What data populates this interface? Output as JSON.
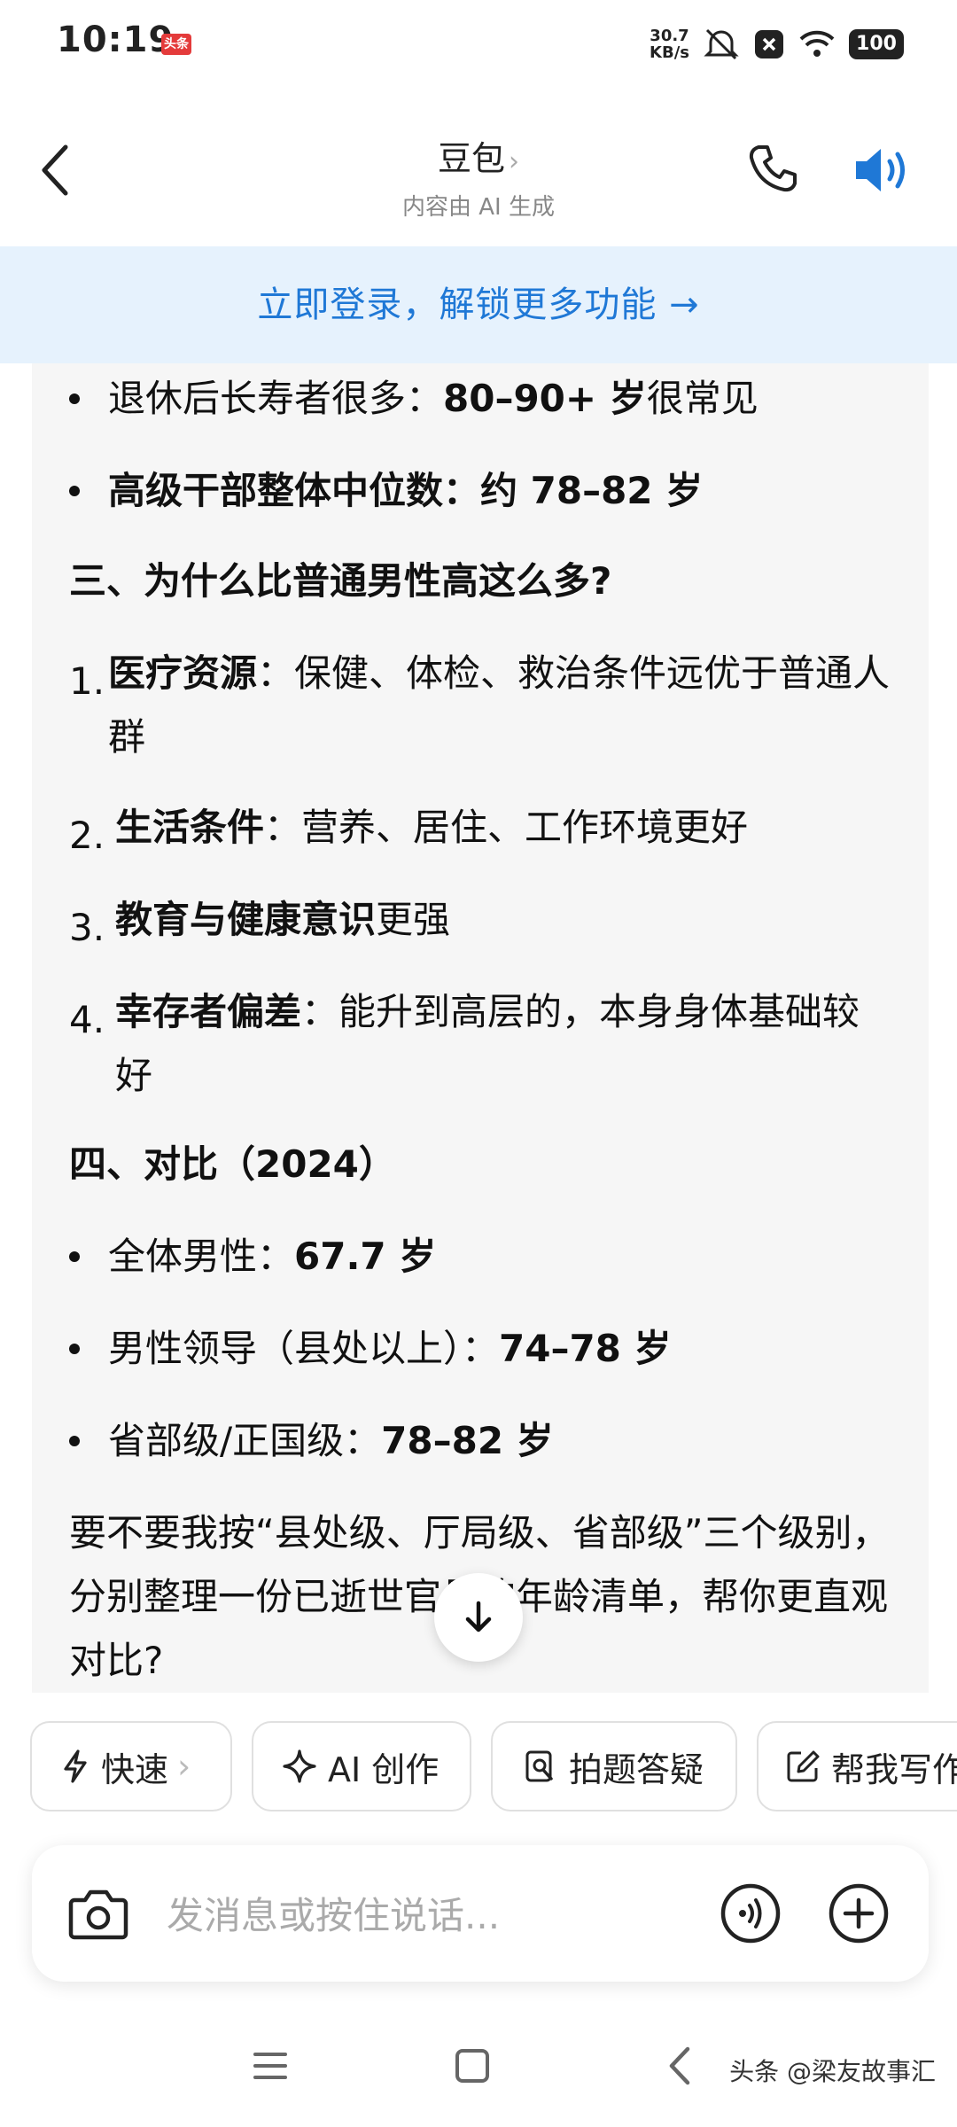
{
  "status_bar": {
    "time": "10:19",
    "badge": "头条",
    "speed_value": "30.7",
    "speed_unit": "KB/s",
    "battery": "100",
    "icons": [
      "mute-icon",
      "close-box-icon",
      "wifi-icon",
      "battery-icon"
    ]
  },
  "header": {
    "title": "豆包",
    "title_chevron": "›",
    "subtitle": "内容由 AI 生成"
  },
  "banner": {
    "text": "立即登录，解锁更多功能 →"
  },
  "chat": {
    "bullets_top": [
      {
        "plain_before": "退休后长寿者很多：",
        "bold": "80–90+ 岁",
        "plain_after": "很常见"
      },
      {
        "plain_before": "",
        "bold": "高级干部整体中位数：约 78–82 岁",
        "plain_after": ""
      }
    ],
    "heading_3": "三、为什么比普通男性高这么多?",
    "numbered": [
      {
        "num": "1.",
        "bold": "医疗资源",
        "rest": "：保健、体检、救治条件远优于普通人群"
      },
      {
        "num": "2.",
        "bold": "生活条件",
        "rest": "：营养、居住、工作环境更好"
      },
      {
        "num": "3.",
        "bold": "教育与健康意识",
        "rest": "更强"
      },
      {
        "num": "4.",
        "bold": "幸存者偏差",
        "rest": "：能升到高层的，本身身体基础较好"
      }
    ],
    "heading_4": "四、对比（2024）",
    "bullets_compare": [
      {
        "label": "全体男性：",
        "value": "67.7 岁"
      },
      {
        "label": "男性领导（县处以上）：",
        "value": "74–78 岁"
      },
      {
        "label": "省部级/正国级：",
        "value": "78–82 岁"
      }
    ],
    "followup": "要不要我按“县处级、厅局级、省部级”三个级别，分别整理一份已逝世官员的年龄清单，帮你更直观对比?"
  },
  "chips": [
    {
      "label": "快速",
      "icon": "lightning-icon",
      "chevron": "›"
    },
    {
      "label": "AI 创作",
      "icon": "sparkle-icon"
    },
    {
      "label": "拍题答疑",
      "icon": "scan-question-icon"
    },
    {
      "label": "帮我写作",
      "icon": "edit-icon"
    }
  ],
  "input": {
    "placeholder": "发消息或按住说话..."
  },
  "watermark": "头条 @梁友故事汇",
  "colors": {
    "accent": "#1f78d6",
    "banner_bg": "#e6f2fd",
    "chat_bg": "#f6f6f6"
  }
}
